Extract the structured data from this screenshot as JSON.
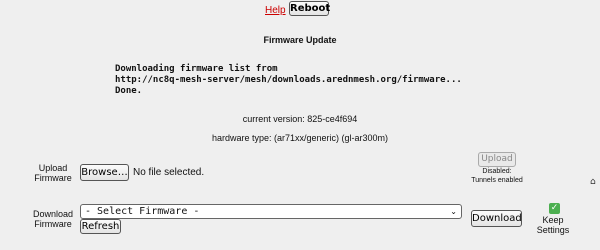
{
  "header": {
    "help_label": "Help",
    "reboot_label": "Reboot"
  },
  "section": {
    "title": "Firmware Update"
  },
  "log": {
    "lines": [
      "Downloading firmware list from",
      "http://nc8q-mesh-server/mesh/downloads.arednmesh.org/firmware...",
      "Done."
    ]
  },
  "info": {
    "current_version": "current version: 825-ce4f694",
    "hardware_type": "hardware type: (ar71xx/generic) (gl-ar300m)"
  },
  "upload": {
    "label": "Upload Firmware",
    "browse_label": "Browse…",
    "file_status": "No file selected.",
    "button_label": "Upload",
    "button_disabled": true,
    "note": "Disabled: Tunnels enabled"
  },
  "download": {
    "label": "Download Firmware",
    "select_value": "- Select Firmware -",
    "refresh_label": "Refresh",
    "button_label": "Download",
    "keep_settings_label": "Keep Settings",
    "keep_settings_checked": true
  },
  "colors": {
    "link": "#cc0000",
    "checkbox": "#4caf50",
    "background": "#efefef"
  }
}
